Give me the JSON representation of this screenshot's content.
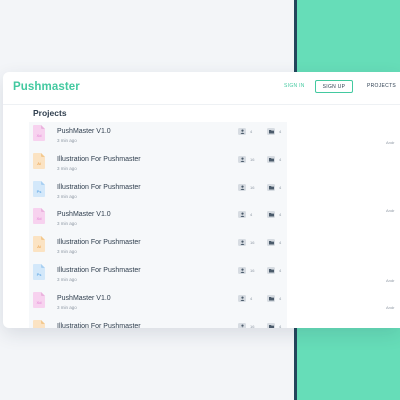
{
  "app": {
    "brand": "Pushmaster"
  },
  "nav": {
    "signin": "SIGN IN",
    "signup": "SIGN UP",
    "projects": "PROJECTS"
  },
  "section": {
    "title": "Projects"
  },
  "colors": {
    "accent": "#43c9a0",
    "green_bg": "#66ddb8",
    "dark_stripe": "#23465c"
  },
  "projects": [
    {
      "title": "PushMaster V1.0",
      "time": "3 min ago",
      "icon": "xd-file-icon",
      "users": "4",
      "folders": "4"
    },
    {
      "title": "Illustration For Pushmaster",
      "time": "3 min ago",
      "icon": "ai-file-icon",
      "users": "16",
      "folders": "4"
    },
    {
      "title": "Illustration For Pushmaster",
      "time": "3 min ago",
      "icon": "ps-file-icon",
      "users": "16",
      "folders": "4"
    },
    {
      "title": "PushMaster V1.0",
      "time": "3 min ago",
      "icon": "xd-file-icon",
      "users": "4",
      "folders": "4"
    },
    {
      "title": "Illustration For Pushmaster",
      "time": "3 min ago",
      "icon": "ai-file-icon",
      "users": "16",
      "folders": "4"
    },
    {
      "title": "Illustration For Pushmaster",
      "time": "3 min ago",
      "icon": "ps-file-icon",
      "users": "16",
      "folders": "4"
    },
    {
      "title": "PushMaster V1.0",
      "time": "3 min ago",
      "icon": "xd-file-icon",
      "users": "4",
      "folders": "4"
    },
    {
      "title": "Illustration For Pushmaster",
      "time": "3 min ago",
      "icon": "ai-file-icon",
      "users": "16",
      "folders": "4"
    }
  ],
  "right_labels": [
    "Andr",
    "Andr",
    "Andr",
    "Andr"
  ]
}
